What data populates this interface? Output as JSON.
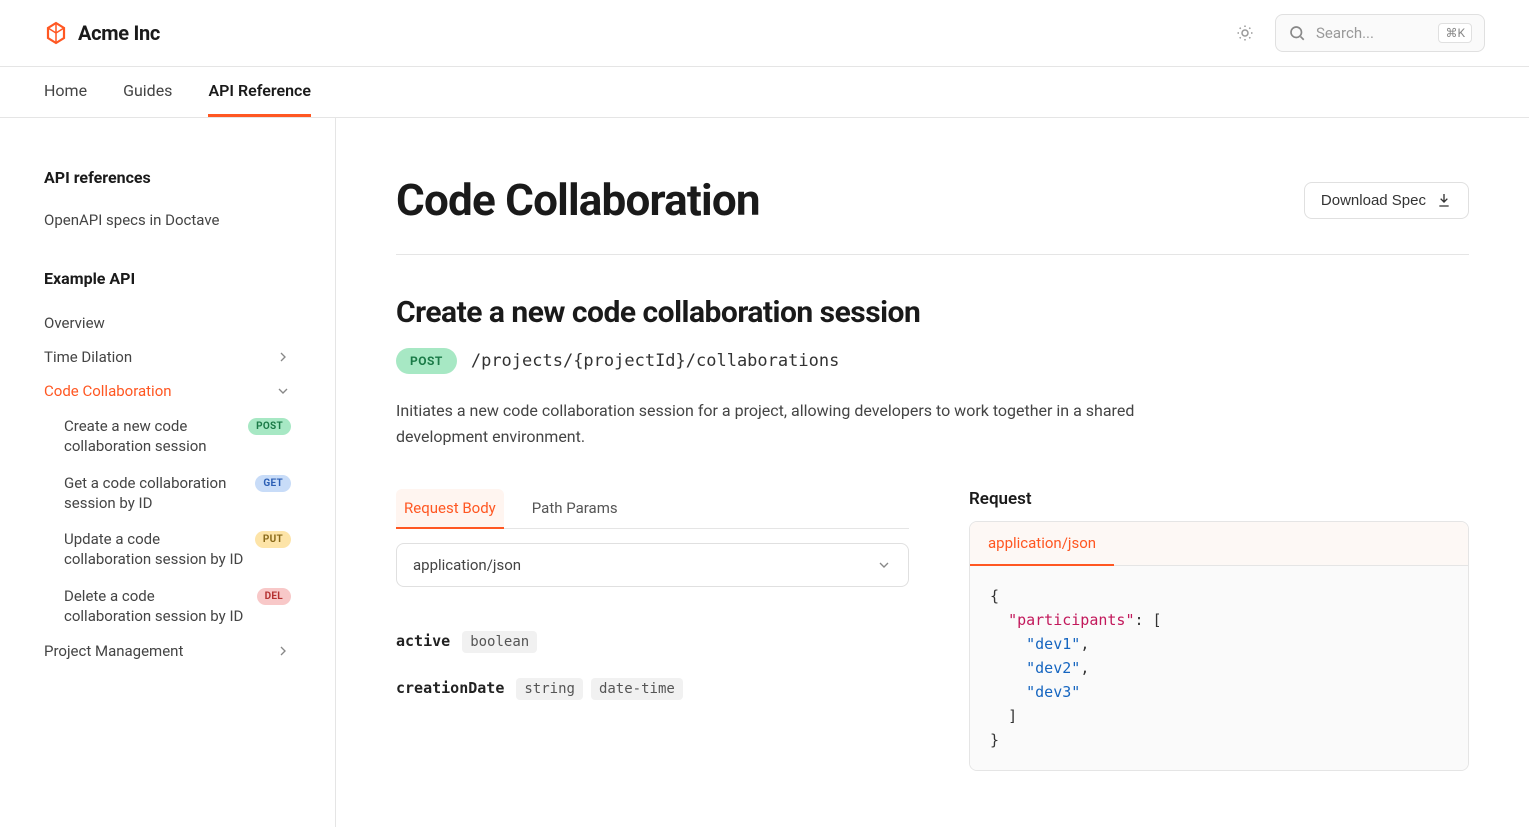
{
  "brand": "Acme Inc",
  "search": {
    "placeholder": "Search...",
    "kbd": "⌘K"
  },
  "topnav": [
    {
      "label": "Home",
      "active": false
    },
    {
      "label": "Guides",
      "active": false
    },
    {
      "label": "API Reference",
      "active": true
    }
  ],
  "sidebar": {
    "heading1": "API references",
    "link1": "OpenAPI specs in Doctave",
    "heading2": "Example API",
    "items": [
      {
        "label": "Overview",
        "type": "plain"
      },
      {
        "label": "Time Dilation",
        "type": "collapsed"
      },
      {
        "label": "Code Collaboration",
        "type": "expanded",
        "active": true,
        "children": [
          {
            "label": "Create a new code collaboration session",
            "method": "POST"
          },
          {
            "label": "Get a code collaboration session by ID",
            "method": "GET"
          },
          {
            "label": "Update a code collaboration session by ID",
            "method": "PUT"
          },
          {
            "label": "Delete a code collaboration session by ID",
            "method": "DEL"
          }
        ]
      },
      {
        "label": "Project Management",
        "type": "collapsed"
      }
    ]
  },
  "main": {
    "title": "Code Collaboration",
    "download": "Download Spec",
    "endpoint_title": "Create a new code collaboration session",
    "method": "POST",
    "path": "/projects/{projectId}/collaborations",
    "description": "Initiates a new code collaboration session for a project, allowing developers to work together in a shared development environment.",
    "tabs": [
      {
        "label": "Request Body",
        "active": true
      },
      {
        "label": "Path Params",
        "active": false
      }
    ],
    "content_type": "application/json",
    "fields": [
      {
        "name": "active",
        "types": [
          "boolean"
        ]
      },
      {
        "name": "creationDate",
        "types": [
          "string",
          "date-time"
        ]
      }
    ],
    "request": {
      "label": "Request",
      "tab": "application/json",
      "tokens": [
        {
          "t": "punc",
          "v": "{"
        },
        {
          "t": "nl",
          "v": ""
        },
        {
          "t": "indent",
          "v": "  "
        },
        {
          "t": "key",
          "v": "\"participants\""
        },
        {
          "t": "punc",
          "v": ": ["
        },
        {
          "t": "nl",
          "v": ""
        },
        {
          "t": "indent",
          "v": "    "
        },
        {
          "t": "str",
          "v": "\"dev1\""
        },
        {
          "t": "punc",
          "v": ","
        },
        {
          "t": "nl",
          "v": ""
        },
        {
          "t": "indent",
          "v": "    "
        },
        {
          "t": "str",
          "v": "\"dev2\""
        },
        {
          "t": "punc",
          "v": ","
        },
        {
          "t": "nl",
          "v": ""
        },
        {
          "t": "indent",
          "v": "    "
        },
        {
          "t": "str",
          "v": "\"dev3\""
        },
        {
          "t": "nl",
          "v": ""
        },
        {
          "t": "indent",
          "v": "  "
        },
        {
          "t": "punc",
          "v": "]"
        },
        {
          "t": "nl",
          "v": ""
        },
        {
          "t": "punc",
          "v": "}"
        }
      ]
    }
  }
}
